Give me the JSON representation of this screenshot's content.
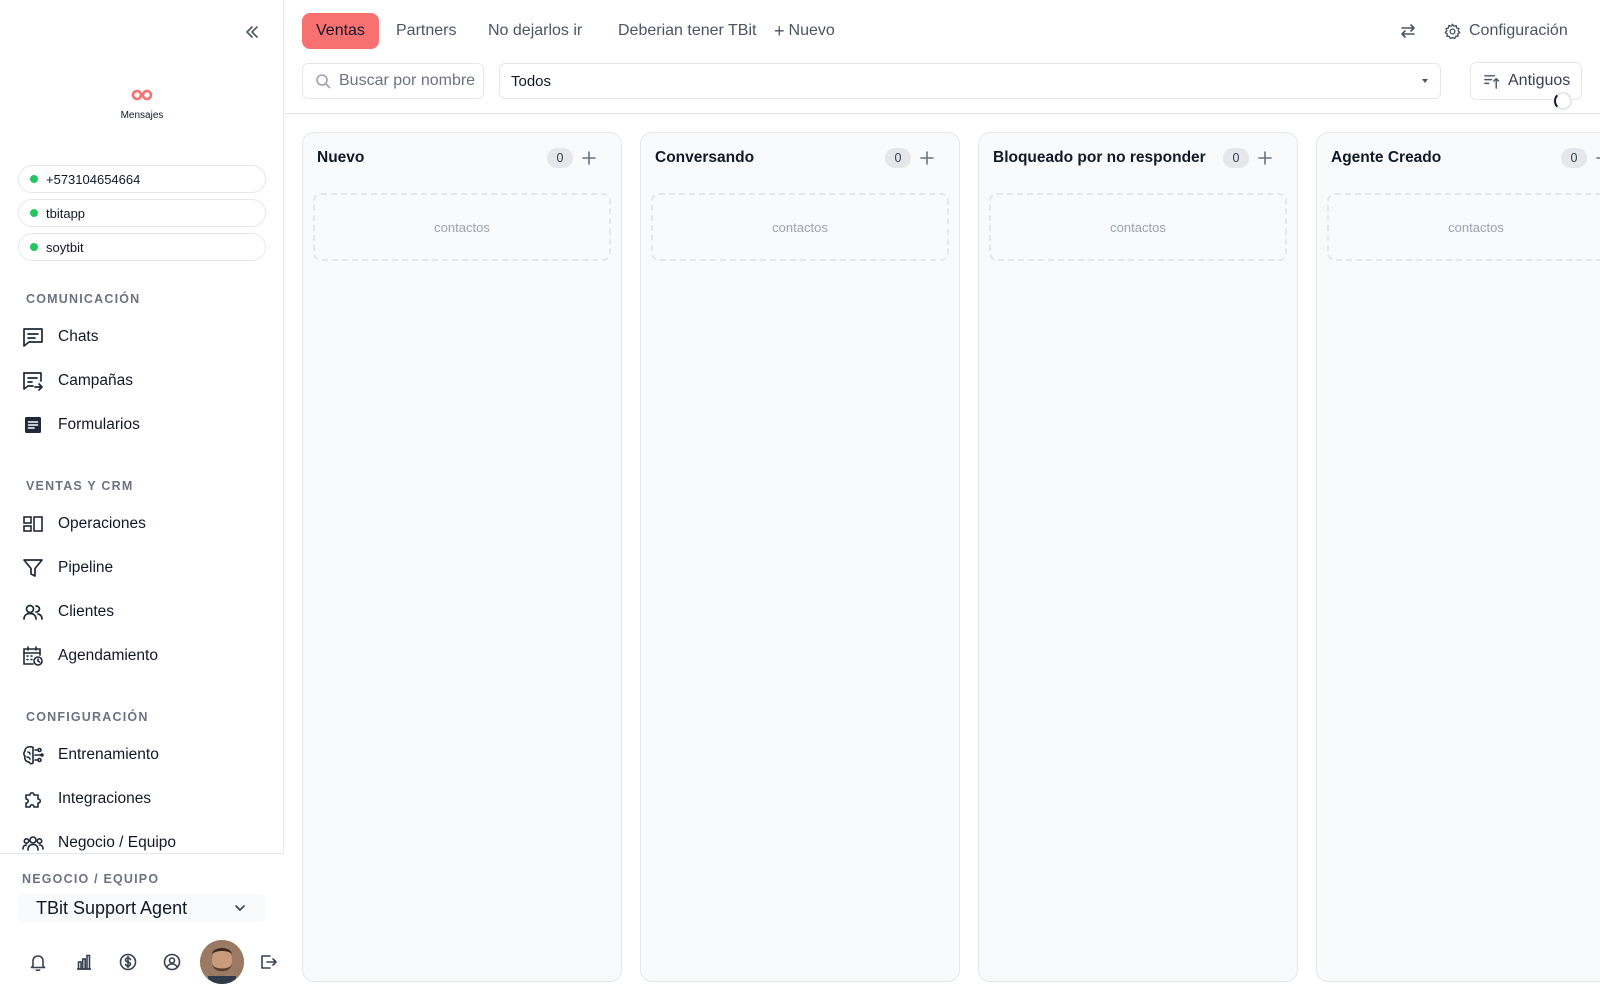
{
  "sidebar": {
    "brand_label": "Mensajes",
    "accounts": [
      "+573104654664",
      "tbitapp",
      "soytbit"
    ],
    "sections": {
      "comunicacion": "COMUNICACIÓN",
      "ventas": "VENTAS Y CRM",
      "configuracion": "CONFIGURACIÓN"
    },
    "nav": {
      "chats": "Chats",
      "campanas": "Campañas",
      "formularios": "Formularios",
      "operaciones": "Operaciones",
      "pipeline": "Pipeline",
      "clientes": "Clientes",
      "agendamiento": "Agendamiento",
      "entrenamiento": "Entrenamiento",
      "integraciones": "Integraciones",
      "negocio": "Negocio / Equipo"
    },
    "footer": {
      "team_label": "NEGOCIO / EQUIPO",
      "team_value": "TBit Support Agent"
    }
  },
  "tabs": {
    "ventas": "Ventas",
    "partners": "Partners",
    "no_dejarlos": "No dejarlos ir",
    "deberian": "Deberian tener TBit",
    "nuevo": "Nuevo"
  },
  "settings_label": "Configuración",
  "filters": {
    "search_placeholder": "Buscar por nombre",
    "select_value": "Todos",
    "sort_label": "Antiguos"
  },
  "columns": [
    {
      "title": "Nuevo",
      "count": "0",
      "empty": "contactos"
    },
    {
      "title": "Conversando",
      "count": "0",
      "empty": "contactos"
    },
    {
      "title": "Bloqueado por no responder",
      "count": "0",
      "empty": "contactos"
    },
    {
      "title": "Agente Creado",
      "count": "0",
      "empty": "contactos"
    }
  ],
  "colors": {
    "accent": "#f87171",
    "online": "#22c55e"
  }
}
